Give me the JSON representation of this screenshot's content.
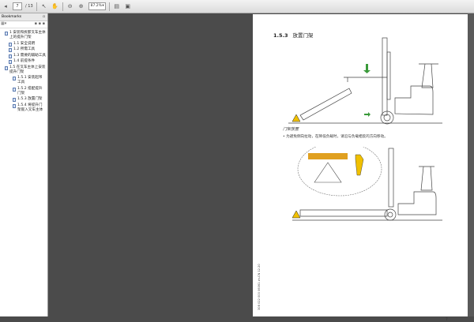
{
  "toolbar": {
    "current_page": "7",
    "total_pages": "/ 13",
    "zoom": "87.2%"
  },
  "sidebar": {
    "title": "Bookmarks",
    "items": [
      {
        "label": "1 安装和拆卸叉车主体上的提升门架"
      },
      {
        "label": "1.1 安全说明"
      },
      {
        "label": "1.2 所需工具"
      },
      {
        "label": "1.3 需要的辅助工具"
      },
      {
        "label": "1.4 前提条件"
      },
      {
        "label": "1.5 在叉车主体上安装提升门架"
      },
      {
        "label": "1.5.1 安装起吊工具"
      },
      {
        "label": "1.5.2 搭配提升门架"
      },
      {
        "label": "1.5.3 放置门架"
      },
      {
        "label": "1.5.4 将提升门架嵌入叉车主体"
      }
    ]
  },
  "page": {
    "section_number": "1.5.3",
    "section_title": "放置门架",
    "caption": "门架放置",
    "bullet": "为避免侧向拉动，在降低负载时，请沿与负载相反的方向移动。",
    "side_code": "308 022 000 06061 zh-CN 12.20",
    "page_number": "7"
  },
  "colors": {
    "warning": "#f0c000",
    "accent_orange": "#e0a020",
    "arrow_green": "#3a9a3a"
  }
}
